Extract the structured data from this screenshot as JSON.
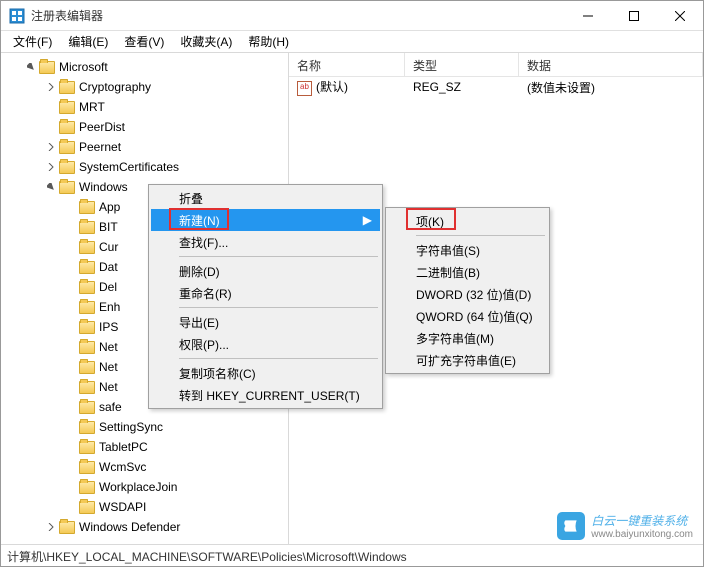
{
  "window": {
    "title": "注册表编辑器"
  },
  "menubar": {
    "file": "文件(F)",
    "edit": "编辑(E)",
    "view": "查看(V)",
    "favorites": "收藏夹(A)",
    "help": "帮助(H)"
  },
  "tree": {
    "root": "Microsoft",
    "children": [
      {
        "label": "Cryptography",
        "expandable": true
      },
      {
        "label": "MRT",
        "expandable": false
      },
      {
        "label": "PeerDist",
        "expandable": false
      },
      {
        "label": "Peernet",
        "expandable": true
      },
      {
        "label": "SystemCertificates",
        "expandable": true
      },
      {
        "label": "Windows",
        "expandable": true,
        "expanded": true,
        "children": [
          {
            "label": "App"
          },
          {
            "label": "BIT"
          },
          {
            "label": "Cur"
          },
          {
            "label": "Dat"
          },
          {
            "label": "Del"
          },
          {
            "label": "Enh"
          },
          {
            "label": "IPS"
          },
          {
            "label": "Net"
          },
          {
            "label": "Net"
          },
          {
            "label": "Net"
          },
          {
            "label": "safe"
          },
          {
            "label": "SettingSync"
          },
          {
            "label": "TabletPC"
          },
          {
            "label": "WcmSvc"
          },
          {
            "label": "WorkplaceJoin"
          },
          {
            "label": "WSDAPI"
          }
        ]
      },
      {
        "label": "Windows Defender",
        "expandable": true
      }
    ]
  },
  "list": {
    "headers": {
      "name": "名称",
      "type": "类型",
      "data": "数据"
    },
    "rows": [
      {
        "name": "(默认)",
        "type": "REG_SZ",
        "data": "(数值未设置)"
      }
    ]
  },
  "contextMenu1": {
    "collapse": "折叠",
    "new": "新建(N)",
    "find": "查找(F)...",
    "delete": "删除(D)",
    "rename": "重命名(R)",
    "export": "导出(E)",
    "permissions": "权限(P)...",
    "copyKeyName": "复制项名称(C)",
    "goto": "转到 HKEY_CURRENT_USER(T)"
  },
  "contextMenu2": {
    "key": "项(K)",
    "string": "字符串值(S)",
    "binary": "二进制值(B)",
    "dword": "DWORD (32 位)值(D)",
    "qword": "QWORD (64 位)值(Q)",
    "multistring": "多字符串值(M)",
    "expandstring": "可扩充字符串值(E)"
  },
  "statusbar": {
    "path": "计算机\\HKEY_LOCAL_MACHINE\\SOFTWARE\\Policies\\Microsoft\\Windows"
  },
  "watermark": {
    "main": "白云一键重装系统",
    "sub": "www.baiyunxitong.com"
  }
}
